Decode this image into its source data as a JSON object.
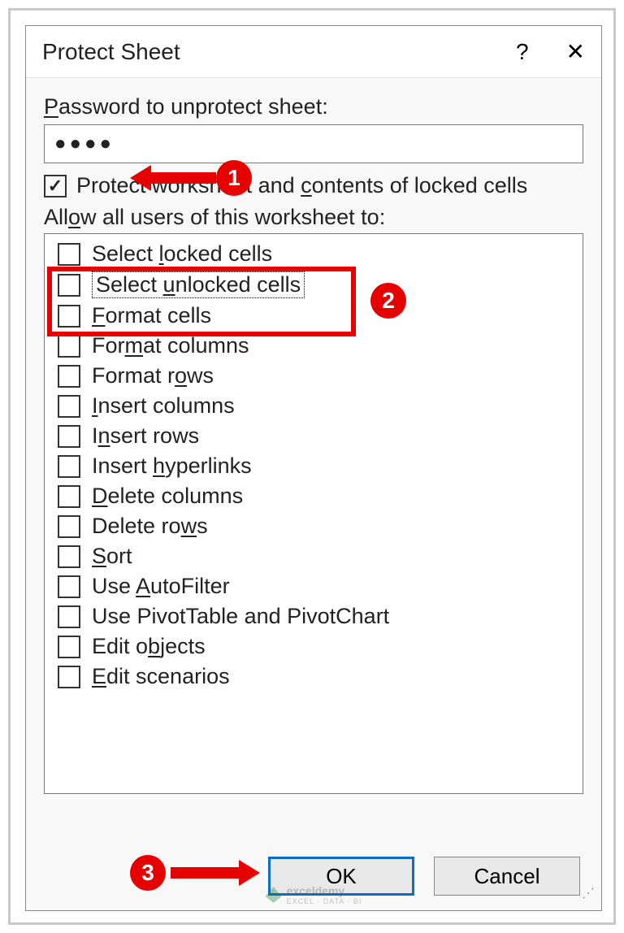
{
  "title": "Protect Sheet",
  "password_label": "Password to unprotect sheet:",
  "password_value": "●●●●",
  "protect_label": "Protect worksheet and contents of locked cells",
  "allow_label": "Allow all users of this worksheet to:",
  "items": [
    {
      "label": "Select locked cells",
      "checked": false
    },
    {
      "label": "Select unlocked cells",
      "checked": false,
      "focused": true
    },
    {
      "label": "Format cells",
      "checked": false
    },
    {
      "label": "Format columns",
      "checked": false
    },
    {
      "label": "Format rows",
      "checked": false
    },
    {
      "label": "Insert columns",
      "checked": false
    },
    {
      "label": "Insert rows",
      "checked": false
    },
    {
      "label": "Insert hyperlinks",
      "checked": false
    },
    {
      "label": "Delete columns",
      "checked": false
    },
    {
      "label": "Delete rows",
      "checked": false
    },
    {
      "label": "Sort",
      "checked": false
    },
    {
      "label": "Use AutoFilter",
      "checked": false
    },
    {
      "label": "Use PivotTable and PivotChart",
      "checked": false
    },
    {
      "label": "Edit objects",
      "checked": false
    },
    {
      "label": "Edit scenarios",
      "checked": false
    }
  ],
  "buttons": {
    "ok": "OK",
    "cancel": "Cancel"
  },
  "annotations": {
    "n1": "1",
    "n2": "2",
    "n3": "3"
  },
  "watermark": {
    "brand": "exceldemy",
    "tag": "EXCEL · DATA · BI"
  }
}
